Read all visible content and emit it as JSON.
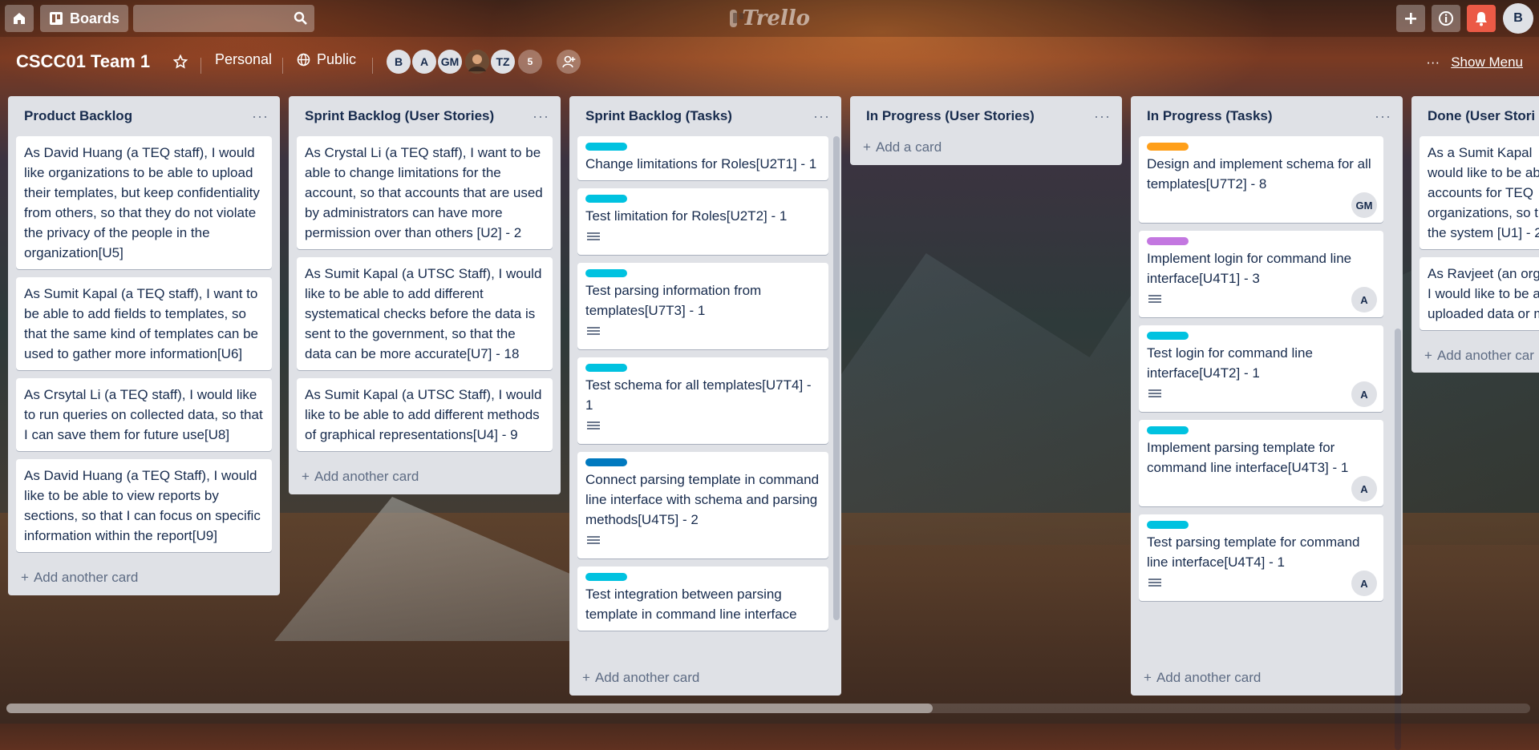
{
  "header": {
    "boards_label": "Boards",
    "logo_text": "Trello",
    "user_initial": "B"
  },
  "board": {
    "title": "CSCC01 Team 1",
    "team": "Personal",
    "visibility": "Public",
    "members": [
      "B",
      "A",
      "GM",
      "",
      "TZ",
      "5"
    ],
    "show_menu": "Show Menu",
    "show_menu_dots": "···"
  },
  "lists": [
    {
      "title": "Product Backlog",
      "add_label": "Add another card",
      "cards": [
        {
          "text": "As David Huang (a TEQ staff), I would like organizations to be able to upload their templates, but keep confidentiality from others, so that they do not violate the privacy of the people in the organization[U5]"
        },
        {
          "text": "As Sumit Kapal (a TEQ staff), I want to be able to add fields to templates, so that the same kind of templates can be used to gather more information[U6]"
        },
        {
          "text": "As Crsytal Li (a TEQ staff), I would like to run queries on collected data, so that I can save them for future use[U8]"
        },
        {
          "text": "As David Huang (a TEQ Staff), I would like to be able to view reports by sections, so that I can focus on specific information within the report[U9]"
        }
      ]
    },
    {
      "title": "Sprint Backlog (User Stories)",
      "add_label": "Add another card",
      "cards": [
        {
          "text": "As Crystal Li (a TEQ staff), I want to be able to change limitations for the account, so that accounts that are used by administrators can have more permission over than others [U2] - 2"
        },
        {
          "text": "As Sumit Kapal (a UTSC Staff), I would like to be able to add different systematical checks before the data is sent to the government, so that the data can be more accurate[U7] - 18"
        },
        {
          "text": "As Sumit Kapal (a UTSC Staff), I would like to be able to add different methods of graphical representations[U4] - 9"
        }
      ]
    },
    {
      "title": "Sprint Backlog (Tasks)",
      "add_label": "Add another card",
      "cards": [
        {
          "label_color": "#00c2e0",
          "text": "Change limitations for Roles[U2T1] - 1",
          "desc": false
        },
        {
          "label_color": "#00c2e0",
          "text": "Test limitation for Roles[U2T2] - 1",
          "desc": true
        },
        {
          "label_color": "#00c2e0",
          "text": "Test parsing information from templates[U7T3] - 1",
          "desc": true
        },
        {
          "label_color": "#00c2e0",
          "text": "Test schema for all templates[U7T4] - 1",
          "desc": true
        },
        {
          "label_color": "#0079bf",
          "text": "Connect parsing template in command line interface with schema and parsing methods[U4T5] - 2",
          "desc": true
        },
        {
          "label_color": "#00c2e0",
          "text": "Test integration between parsing template in command line interface",
          "desc": false
        }
      ]
    },
    {
      "title": "In Progress (User Stories)",
      "add_label": "Add a card",
      "cards": []
    },
    {
      "title": "In Progress (Tasks)",
      "add_label": "Add another card",
      "cards": [
        {
          "label_color": "#ff9f1a",
          "text": "Design and implement schema for all templates[U7T2] - 8",
          "desc": false,
          "member": "GM"
        },
        {
          "label_color": "#c377e0",
          "text": "Implement login for command line interface[U4T1] - 3",
          "desc": true,
          "member": "A"
        },
        {
          "label_color": "#00c2e0",
          "text": "Test login for command line interface[U4T2] - 1",
          "desc": true,
          "member": "A"
        },
        {
          "label_color": "#00c2e0",
          "text": "Implement parsing template for command line interface[U4T3] - 1",
          "desc": false,
          "member": "A"
        },
        {
          "label_color": "#00c2e0",
          "text": "Test parsing template for command line interface[U4T4] - 1",
          "desc": true,
          "member": "A"
        }
      ]
    },
    {
      "title": "Done (User Stori",
      "add_label": "Add another car",
      "cards": [
        {
          "text": "As a Sumit Kapal would like to be ab accounts for TEQ organizations, so t the system [U1] - 2"
        },
        {
          "text": "As Ravjeet (an org I would like to be a uploaded data or m"
        }
      ]
    }
  ]
}
